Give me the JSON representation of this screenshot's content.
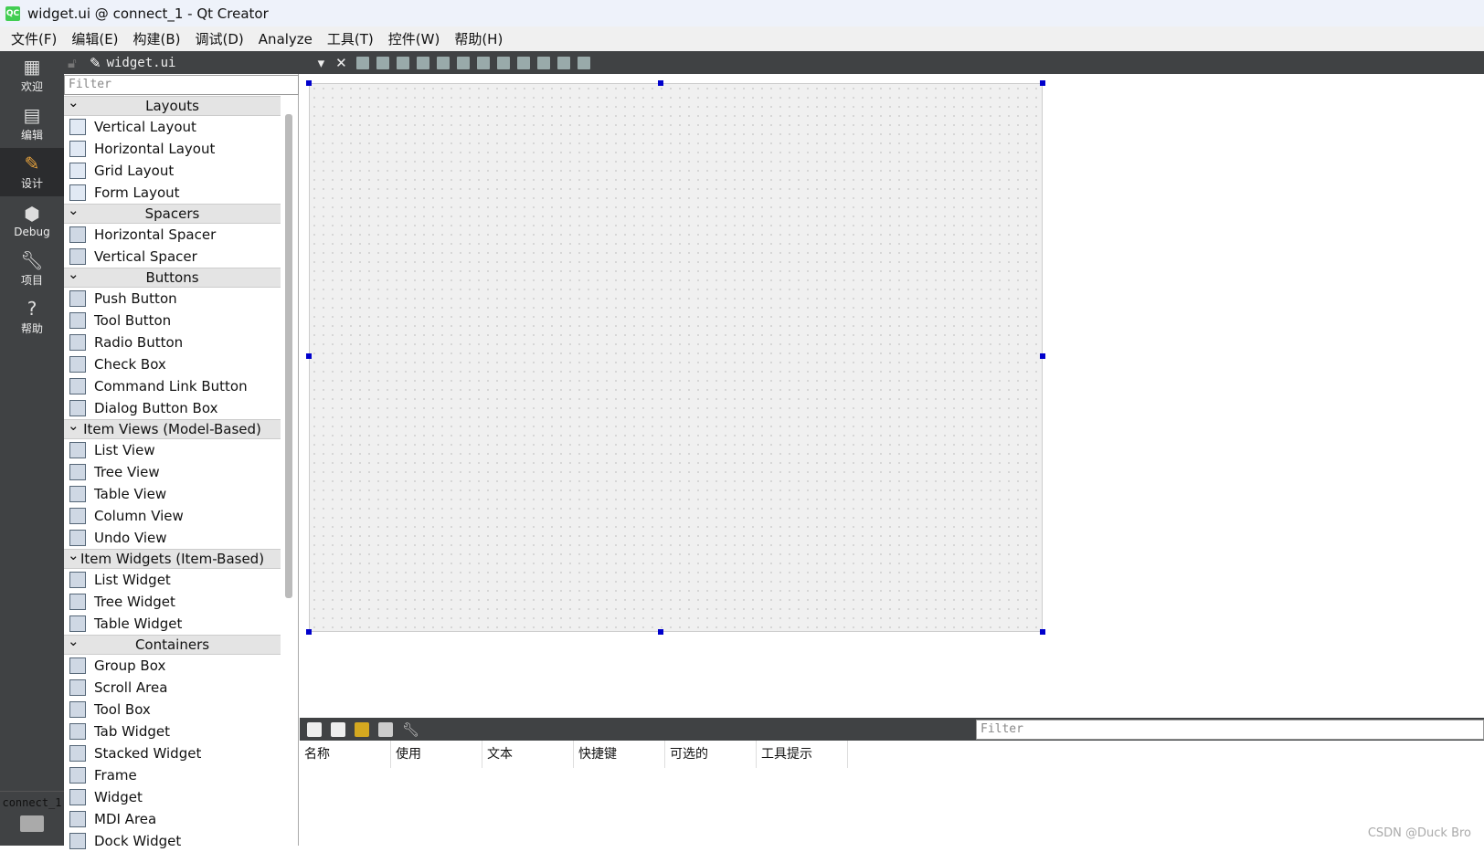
{
  "window": {
    "title": "widget.ui @ connect_1 - Qt Creator",
    "logo": "QC"
  },
  "menu": [
    "文件(F)",
    "编辑(E)",
    "构建(B)",
    "调试(D)",
    "Analyze",
    "工具(T)",
    "控件(W)",
    "帮助(H)"
  ],
  "modes": [
    {
      "label": "欢迎",
      "icon": "grid-icon"
    },
    {
      "label": "编辑",
      "icon": "document-icon"
    },
    {
      "label": "设计",
      "icon": "pencil-icon",
      "selected": true
    },
    {
      "label": "Debug",
      "icon": "bug-icon"
    },
    {
      "label": "项目",
      "icon": "wrench-icon"
    },
    {
      "label": "帮助",
      "icon": "help-icon"
    }
  ],
  "project": "connect_1",
  "document": {
    "name": "widget.ui"
  },
  "widgetbox": {
    "filter_placeholder": "Filter",
    "categories": [
      {
        "name": "Layouts",
        "items": [
          "Vertical Layout",
          "Horizontal Layout",
          "Grid Layout",
          "Form Layout"
        ]
      },
      {
        "name": "Spacers",
        "items": [
          "Horizontal Spacer",
          "Vertical Spacer"
        ]
      },
      {
        "name": "Buttons",
        "items": [
          "Push Button",
          "Tool Button",
          "Radio Button",
          "Check Box",
          "Command Link Button",
          "Dialog Button Box"
        ]
      },
      {
        "name": "Item Views (Model-Based)",
        "items": [
          "List View",
          "Tree View",
          "Table View",
          "Column View",
          "Undo View"
        ]
      },
      {
        "name": "Item Widgets (Item-Based)",
        "items": [
          "List Widget",
          "Tree Widget",
          "Table Widget"
        ]
      },
      {
        "name": "Containers",
        "items": [
          "Group Box",
          "Scroll Area",
          "Tool Box",
          "Tab Widget",
          "Stacked Widget",
          "Frame",
          "Widget",
          "MDI Area",
          "Dock Widget"
        ]
      }
    ]
  },
  "action_editor": {
    "filter_placeholder": "Filter",
    "columns": [
      "名称",
      "使用",
      "文本",
      "快捷键",
      "可选的",
      "工具提示"
    ]
  },
  "watermark": "CSDN @Duck Bro"
}
